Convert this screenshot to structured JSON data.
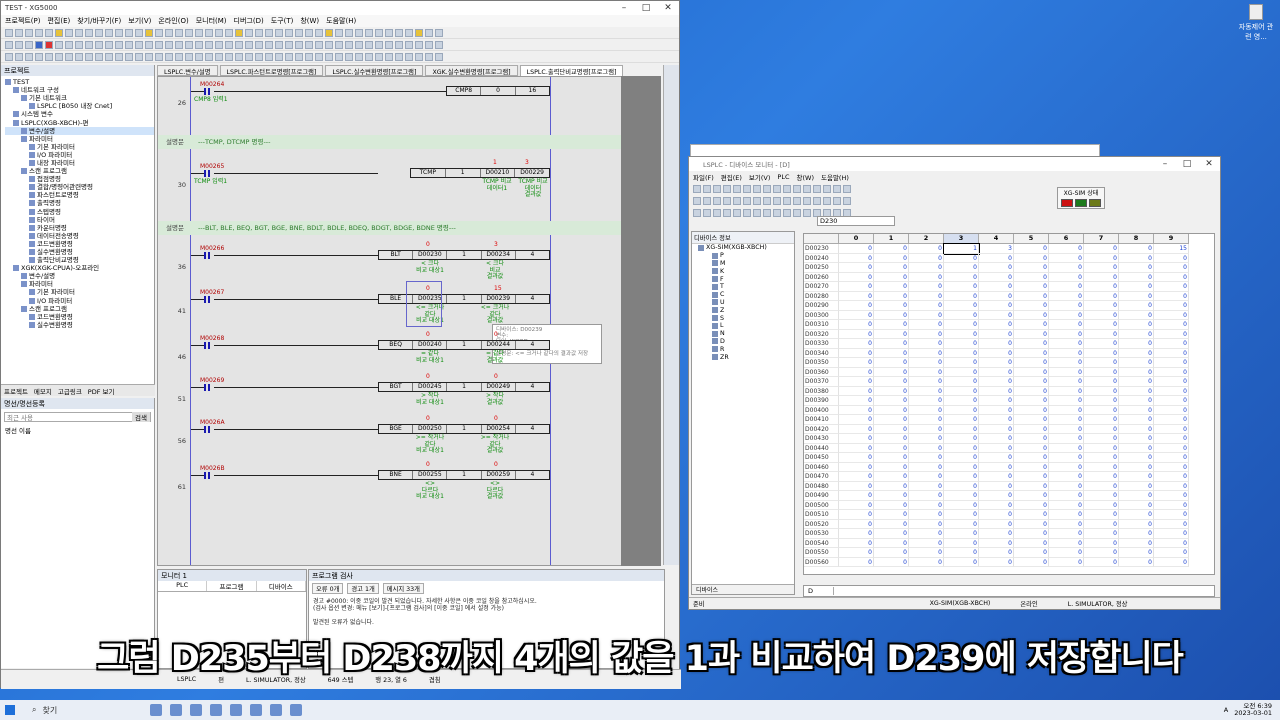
{
  "desktop": {
    "icon_label": "자동제어 관련 영..."
  },
  "xg": {
    "title": "TEST - XG5000",
    "menu": [
      "프로젝트(P)",
      "편집(E)",
      "찾기/바꾸기(F)",
      "보기(V)",
      "온라인(O)",
      "모니터(M)",
      "디버그(D)",
      "도구(T)",
      "창(W)",
      "도움말(H)"
    ],
    "left_header": "프로젝트",
    "tree": [
      {
        "label": "TEST",
        "indent": 0
      },
      {
        "label": "네트워크 구성",
        "indent": 1
      },
      {
        "label": "기본 네트워크",
        "indent": 2
      },
      {
        "label": "LSPLC [B050 내장 Cnet]",
        "indent": 3
      },
      {
        "label": "시스템 변수",
        "indent": 1
      },
      {
        "label": "LSPLC(XGB-XBCH)-편",
        "indent": 1
      },
      {
        "label": "변수/설명",
        "indent": 2,
        "selected": true
      },
      {
        "label": "파라미터",
        "indent": 2
      },
      {
        "label": "기본 파라미터",
        "indent": 3
      },
      {
        "label": "I/O 파라미터",
        "indent": 3
      },
      {
        "label": "내장 파라미터",
        "indent": 3
      },
      {
        "label": "스캔 프로그램",
        "indent": 2
      },
      {
        "label": "접점명령",
        "indent": 3
      },
      {
        "label": "결합/명령어관련명령",
        "indent": 3
      },
      {
        "label": "파스턴트로명령",
        "indent": 3
      },
      {
        "label": "출력명령",
        "indent": 3
      },
      {
        "label": "스텝명령",
        "indent": 3
      },
      {
        "label": "타이머",
        "indent": 3
      },
      {
        "label": "카운터명령",
        "indent": 3
      },
      {
        "label": "데이터전송명령",
        "indent": 3
      },
      {
        "label": "코드변환명령",
        "indent": 3
      },
      {
        "label": "실수변환명령",
        "indent": 3
      },
      {
        "label": "출력단비교명령",
        "indent": 3
      },
      {
        "label": "XGK(XGK-CPUA)-오프라인",
        "indent": 1
      },
      {
        "label": "변수/설명",
        "indent": 2
      },
      {
        "label": "파라미터",
        "indent": 2
      },
      {
        "label": "기본 파라미터",
        "indent": 3
      },
      {
        "label": "I/O 파라미터",
        "indent": 3
      },
      {
        "label": "스캔 프로그램",
        "indent": 2
      },
      {
        "label": "코드변환명령",
        "indent": 3
      },
      {
        "label": "실수변환명령",
        "indent": 3
      }
    ],
    "left_tabs": [
      "프로젝트",
      "메모지",
      "고급링크",
      "PDF 보기"
    ],
    "comm_header": "명선/명선등록",
    "comm_placeholder": "최근 사용",
    "comm_btn": "검색",
    "comm_item": "명선 이름",
    "tabs": [
      "LSPLC.변수/설명",
      "LSPLC.파스턴트로명령[프로그램]",
      "LSPLC.실수변환명령[프로그램]",
      "XGK.실수변환명령[프로그램]",
      "LSPLC.출력단비교명령[프로그램]"
    ],
    "rungs": [
      {
        "no": "26",
        "contact": "M00264",
        "comment": "CMP8 입력1",
        "fn": [
          "CMP8",
          "0",
          "16"
        ],
        "vals": [
          "",
          "",
          ""
        ],
        "out": [
          "",
          "",
          ""
        ]
      },
      {
        "no": "30",
        "contact": "M00265",
        "comment": "TCMP 입력1",
        "fn": [
          "TCMP",
          "1",
          "D00210",
          "D00229"
        ],
        "vals": [
          "1",
          "3"
        ],
        "out": [
          "TCMP 비교\n데이터1",
          "TCMP 비교\n데이터\n결과값"
        ]
      },
      {
        "no": "36",
        "contact": "M00266",
        "comment": "",
        "fn": [
          "BLT",
          "D00230",
          "1",
          "D00234",
          "4"
        ],
        "vals": [
          "0",
          "3"
        ],
        "out": [
          "< 크다\n비교 대상1",
          "< 크다\n비교\n결과값"
        ]
      },
      {
        "no": "41",
        "contact": "M00267",
        "comment": "",
        "fn": [
          "BLE",
          "D00235",
          "1",
          "D00239",
          "4"
        ],
        "vals": [
          "0",
          "15"
        ],
        "out": [
          "<= 크거나\n같다\n비교 대상1",
          "<= 크거나\n같다\n결과값"
        ]
      },
      {
        "no": "46",
        "contact": "M00268",
        "comment": "",
        "fn": [
          "BEQ",
          "D00240",
          "1",
          "D00244",
          "4"
        ],
        "vals": [
          "0",
          "0"
        ],
        "out": [
          "= 같다\n비교 대상1",
          "= 같다\n결과값"
        ]
      },
      {
        "no": "51",
        "contact": "M00269",
        "comment": "",
        "fn": [
          "BGT",
          "D00245",
          "1",
          "D00249",
          "4"
        ],
        "vals": [
          "0",
          "0"
        ],
        "out": [
          "> 작다\n비교 대상1",
          "> 작다\n결과값"
        ]
      },
      {
        "no": "56",
        "contact": "M0026A",
        "comment": "",
        "fn": [
          "BGE",
          "D00250",
          "1",
          "D00254",
          "4"
        ],
        "vals": [
          "0",
          "0"
        ],
        "out": [
          ">= 작거나\n같다\n비교 대상1",
          ">= 작거나\n같다\n결과값"
        ]
      },
      {
        "no": "61",
        "contact": "M0026B",
        "comment": "",
        "fn": [
          "BNE",
          "D00255",
          "1",
          "D00259",
          "4"
        ],
        "vals": [
          "0",
          "0"
        ],
        "out": [
          "<>\n다르다\n비교 대상1",
          "<>\n다르다\n결과값"
        ]
      }
    ],
    "comment_rows": [
      {
        "label": "설명문",
        "text": "---TCMP, DTCMP 명령---"
      },
      {
        "label": "설명문",
        "text": "---BLT, BLE, BEQ, BGT, BGE, BNE, BDLT, BDLE, BDEQ, BDGT, BDGE, BDNE 명령---"
      }
    ],
    "tooltip": [
      "디바이스: D00239",
      "변수:",
      "타입: WORD",
      "크기: 2",
      "설명문: <= 크거나 같다의 결과값 저장"
    ],
    "monitor_header": "모니터 1",
    "monitor_cols": [
      "PLC",
      "프로그램",
      "디바이스"
    ],
    "check_header": "프로그램 검사",
    "check_tabs": [
      "오류 0개",
      "경고 1개",
      "메시지 33개"
    ],
    "check_lines": [
      "경고 #0000: 이중 코일이 발견 되었습니다. 자세한 사항은 이중 코일 창을 참고하십시오.",
      "(검사 옵션 변경: 메뉴 [보기]-[프로그램 검사]의 [이중 코일] 에서 설정 가능)",
      "",
      "발견된 오류가 없습니다."
    ],
    "status": [
      "LSPLC",
      "편",
      "L. SIMULATOR, 정상",
      "649 스텝",
      "행 23, 열 6",
      "겹침"
    ]
  },
  "dm": {
    "title": "LSPLC - 디바이스 모니터 - [D]",
    "menu": [
      "파일(F)",
      "편집(E)",
      "보기(V)",
      "PLC",
      "창(W)",
      "도움말(H)"
    ],
    "sim_state_label": "XG-SIM 상태",
    "lamp_colors": [
      "#cc1111",
      "#1d7a1d",
      "#6c7a18"
    ],
    "device_select": "D230",
    "tree_header": "디바이스 정보",
    "tree_root": "XG-SIM(XGB-XBCH)",
    "tree_items": [
      "P",
      "M",
      "K",
      "F",
      "T",
      "C",
      "U",
      "Z",
      "S",
      "L",
      "N",
      "D",
      "R",
      "ZR"
    ],
    "tree_footer": "디바이스",
    "columns": [
      "",
      "0",
      "1",
      "2",
      "3",
      "4",
      "5",
      "6",
      "7",
      "8",
      "9"
    ],
    "grid_footer_tag": "D",
    "status": [
      "준비",
      "XG-SIM(XGB-XBCH)",
      "온라인",
      "L. SIMULATOR, 정상"
    ],
    "rows": [
      [
        "D00230",
        "0",
        "0",
        "0",
        "1",
        "3",
        "0",
        "0",
        "0",
        "0",
        "15"
      ],
      [
        "D00240",
        "0",
        "0",
        "0",
        "0",
        "0",
        "0",
        "0",
        "0",
        "0",
        "0"
      ],
      [
        "D00250",
        "0",
        "0",
        "0",
        "0",
        "0",
        "0",
        "0",
        "0",
        "0",
        "0"
      ],
      [
        "D00260",
        "0",
        "0",
        "0",
        "0",
        "0",
        "0",
        "0",
        "0",
        "0",
        "0"
      ],
      [
        "D00270",
        "0",
        "0",
        "0",
        "0",
        "0",
        "0",
        "0",
        "0",
        "0",
        "0"
      ],
      [
        "D00280",
        "0",
        "0",
        "0",
        "0",
        "0",
        "0",
        "0",
        "0",
        "0",
        "0"
      ],
      [
        "D00290",
        "0",
        "0",
        "0",
        "0",
        "0",
        "0",
        "0",
        "0",
        "0",
        "0"
      ],
      [
        "D00300",
        "0",
        "0",
        "0",
        "0",
        "0",
        "0",
        "0",
        "0",
        "0",
        "0"
      ],
      [
        "D00310",
        "0",
        "0",
        "0",
        "0",
        "0",
        "0",
        "0",
        "0",
        "0",
        "0"
      ],
      [
        "D00320",
        "0",
        "0",
        "0",
        "0",
        "0",
        "0",
        "0",
        "0",
        "0",
        "0"
      ],
      [
        "D00330",
        "0",
        "0",
        "0",
        "0",
        "0",
        "0",
        "0",
        "0",
        "0",
        "0"
      ],
      [
        "D00340",
        "0",
        "0",
        "0",
        "0",
        "0",
        "0",
        "0",
        "0",
        "0",
        "0"
      ],
      [
        "D00350",
        "0",
        "0",
        "0",
        "0",
        "0",
        "0",
        "0",
        "0",
        "0",
        "0"
      ],
      [
        "D00360",
        "0",
        "0",
        "0",
        "0",
        "0",
        "0",
        "0",
        "0",
        "0",
        "0"
      ],
      [
        "D00370",
        "0",
        "0",
        "0",
        "0",
        "0",
        "0",
        "0",
        "0",
        "0",
        "0"
      ],
      [
        "D00380",
        "0",
        "0",
        "0",
        "0",
        "0",
        "0",
        "0",
        "0",
        "0",
        "0"
      ],
      [
        "D00390",
        "0",
        "0",
        "0",
        "0",
        "0",
        "0",
        "0",
        "0",
        "0",
        "0"
      ],
      [
        "D00400",
        "0",
        "0",
        "0",
        "0",
        "0",
        "0",
        "0",
        "0",
        "0",
        "0"
      ],
      [
        "D00410",
        "0",
        "0",
        "0",
        "0",
        "0",
        "0",
        "0",
        "0",
        "0",
        "0"
      ],
      [
        "D00420",
        "0",
        "0",
        "0",
        "0",
        "0",
        "0",
        "0",
        "0",
        "0",
        "0"
      ],
      [
        "D00430",
        "0",
        "0",
        "0",
        "0",
        "0",
        "0",
        "0",
        "0",
        "0",
        "0"
      ],
      [
        "D00440",
        "0",
        "0",
        "0",
        "0",
        "0",
        "0",
        "0",
        "0",
        "0",
        "0"
      ],
      [
        "D00450",
        "0",
        "0",
        "0",
        "0",
        "0",
        "0",
        "0",
        "0",
        "0",
        "0"
      ],
      [
        "D00460",
        "0",
        "0",
        "0",
        "0",
        "0",
        "0",
        "0",
        "0",
        "0",
        "0"
      ],
      [
        "D00470",
        "0",
        "0",
        "0",
        "0",
        "0",
        "0",
        "0",
        "0",
        "0",
        "0"
      ],
      [
        "D00480",
        "0",
        "0",
        "0",
        "0",
        "0",
        "0",
        "0",
        "0",
        "0",
        "0"
      ],
      [
        "D00490",
        "0",
        "0",
        "0",
        "0",
        "0",
        "0",
        "0",
        "0",
        "0",
        "0"
      ],
      [
        "D00500",
        "0",
        "0",
        "0",
        "0",
        "0",
        "0",
        "0",
        "0",
        "0",
        "0"
      ],
      [
        "D00510",
        "0",
        "0",
        "0",
        "0",
        "0",
        "0",
        "0",
        "0",
        "0",
        "0"
      ],
      [
        "D00520",
        "0",
        "0",
        "0",
        "0",
        "0",
        "0",
        "0",
        "0",
        "0",
        "0"
      ],
      [
        "D00530",
        "0",
        "0",
        "0",
        "0",
        "0",
        "0",
        "0",
        "0",
        "0",
        "0"
      ],
      [
        "D00540",
        "0",
        "0",
        "0",
        "0",
        "0",
        "0",
        "0",
        "0",
        "0",
        "0"
      ],
      [
        "D00550",
        "0",
        "0",
        "0",
        "0",
        "0",
        "0",
        "0",
        "0",
        "0",
        "0"
      ],
      [
        "D00560",
        "0",
        "0",
        "0",
        "0",
        "0",
        "0",
        "0",
        "0",
        "0",
        "0"
      ]
    ]
  },
  "subtitle": "그럼 D235부터 D238까지 4개의 값을 1과 비교하여 D239에 저장합니다",
  "taskbar": {
    "search_label": "찾기",
    "time": "오전 6:39",
    "date": "2023-03-01",
    "lang": "A"
  }
}
